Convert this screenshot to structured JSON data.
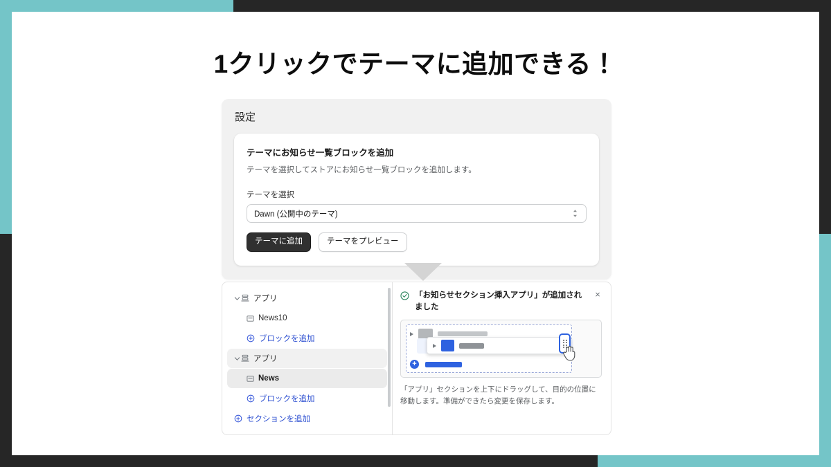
{
  "frame": {
    "teal": "#74c5c8",
    "dark": "#262626"
  },
  "page_title": "1クリックでテーマに追加できる！",
  "settings_card": {
    "title": "設定",
    "theme_block": {
      "heading": "テーマにお知らせ一覧ブロックを追加",
      "description": "テーマを選択してストアにお知らせ一覧ブロックを追加します。",
      "select_label": "テーマを選択",
      "selected_theme": "Dawn (公開中のテーマ)",
      "primary_button": "テーマに追加",
      "secondary_button": "テーマをプレビュー",
      "stepper_icon": "stepper-updown-icon"
    }
  },
  "flow_arrow": {
    "icon": "arrow-down-triangle-icon",
    "color": "#d4d4d4"
  },
  "editor": {
    "sidebar": {
      "rows": [
        {
          "label": "アプリ",
          "type": "group",
          "icon": "app-blocks-icon",
          "chevron": "chevron-down-icon",
          "highlighted": false,
          "selected": false
        },
        {
          "label": "News10",
          "type": "block",
          "icon": "block-square-icon",
          "highlighted": false,
          "selected": false
        },
        {
          "label": "ブロックを追加",
          "type": "link",
          "icon": "plus-circle-icon",
          "highlighted": false,
          "selected": false
        },
        {
          "label": "アプリ",
          "type": "group",
          "icon": "app-blocks-icon",
          "chevron": "chevron-down-icon",
          "highlighted": true,
          "selected": false
        },
        {
          "label": "News",
          "type": "block",
          "icon": "block-square-icon",
          "highlighted": false,
          "selected": true
        },
        {
          "label": "ブロックを追加",
          "type": "link",
          "icon": "plus-circle-icon",
          "highlighted": false,
          "selected": false
        },
        {
          "label": "セクションを追加",
          "type": "link-root",
          "icon": "plus-circle-icon",
          "highlighted": false,
          "selected": false
        }
      ],
      "scrollbar": "sidebar-scrollbar"
    },
    "notice": {
      "icon": "success-check-icon",
      "icon_color": "#29845a",
      "message": "「お知らせセクション挿入アプリ」が追加されました",
      "close_label": "×"
    },
    "illustration": {
      "drag_handle_icon": "drag-handle-grip-icon",
      "cursor_icon": "hand-cursor-icon",
      "add_icon": "plus-circle-icon",
      "accent_color": "#2e62e0"
    },
    "instructions": "「アプリ」セクションを上下にドラッグして、目的の位置に移動します。準備ができたら変更を保存します。"
  }
}
